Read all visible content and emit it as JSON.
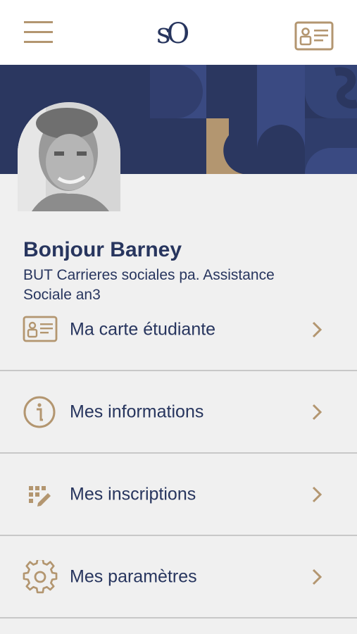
{
  "header": {
    "logo_text": "sO",
    "icons": {
      "menu": "hamburger-menu-icon",
      "card": "student-card-icon"
    }
  },
  "profile": {
    "greeting": "Bonjour Barney",
    "program": "BUT Carrieres sociales pa. Assistance Sociale an3"
  },
  "menu": {
    "items": [
      {
        "label": "Ma carte étudiante",
        "icon": "student-card-icon"
      },
      {
        "label": "Mes informations",
        "icon": "info-icon"
      },
      {
        "label": "Mes inscriptions",
        "icon": "registration-icon"
      },
      {
        "label": "Mes paramètres",
        "icon": "settings-gear-icon"
      }
    ]
  },
  "colors": {
    "navy": "#27355e",
    "banner": "#2b3760",
    "accent": "#b39670",
    "background": "#f0f0f0",
    "divider": "#c8c8c8"
  }
}
